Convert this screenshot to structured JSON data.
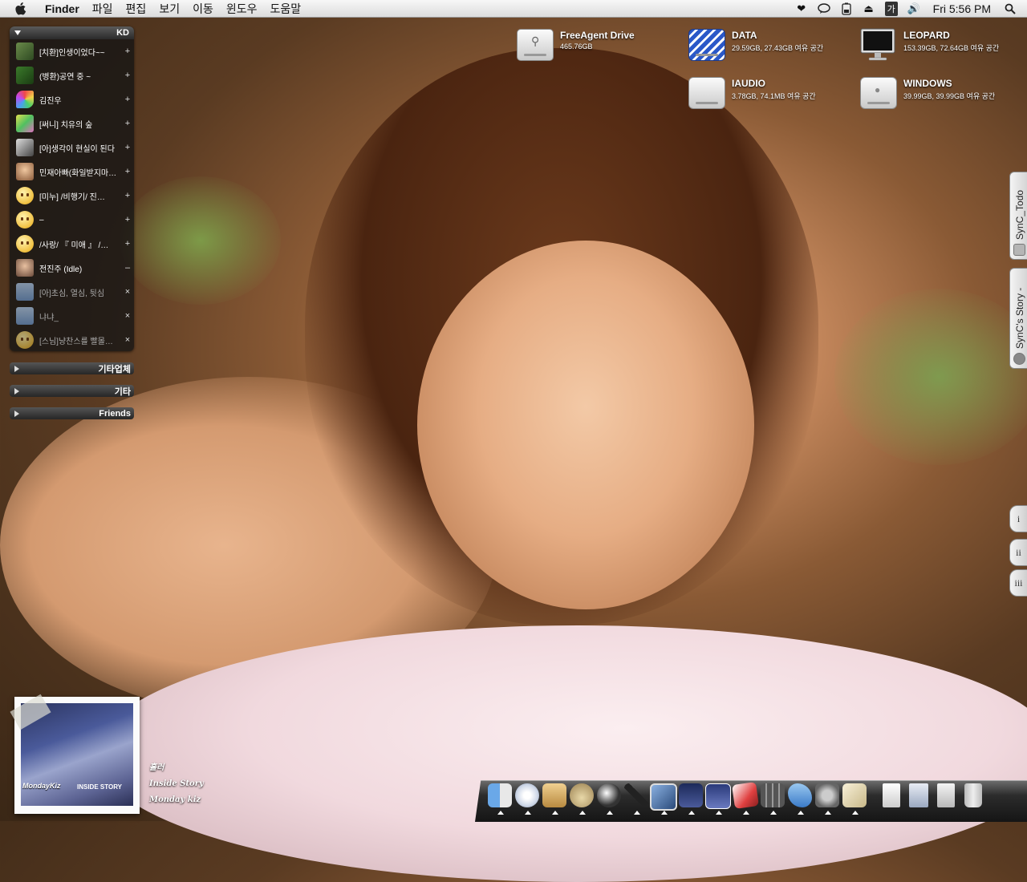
{
  "menubar": {
    "app_name": "Finder",
    "menus": [
      "파일",
      "편집",
      "보기",
      "이동",
      "윈도우",
      "도움말"
    ],
    "input_indicator": "가",
    "clock": "Fri 5:56 PM"
  },
  "buddy_list": {
    "group_name": "KD",
    "buddies": [
      {
        "name": "[치환]인생이었다~~",
        "status": "+"
      },
      {
        "name": "(병환)공연 중 ~",
        "status": "+"
      },
      {
        "name": "김진우",
        "status": "+"
      },
      {
        "name": "[써니] 치유의 숲",
        "status": "+"
      },
      {
        "name": "[아]생각이 현실이 된다",
        "status": "+"
      },
      {
        "name": "민재아빠(화일받지마…",
        "status": "+"
      },
      {
        "name": "[미누] /비행기/ 진…",
        "status": "+"
      },
      {
        "name": "–",
        "status": "+"
      },
      {
        "name": "/사랑/ 『 미애 』 /…",
        "status": "+"
      },
      {
        "name": "전진주 (Idle)",
        "status": "–"
      },
      {
        "name": "[아]초심, 열심, 뒷심",
        "status": "×"
      },
      {
        "name": "냐냐_",
        "status": "×"
      },
      {
        "name": "[스님]냥찬스를 빨몰…",
        "status": "×"
      }
    ],
    "groups": [
      "기타업체",
      "기타",
      "Friends"
    ]
  },
  "desktop_icons": [
    {
      "name": "FreeAgent Drive",
      "detail": "465.76GB"
    },
    {
      "name": "DATA",
      "detail": "29.59GB, 27.43GB 여유 공간"
    },
    {
      "name": "LEOPARD",
      "detail": "153.39GB, 72.64GB 여유 공간"
    },
    {
      "name": "IAUDIO",
      "detail": "3.78GB, 74.1MB 여유 공간"
    },
    {
      "name": "WINDOWS",
      "detail": "39.99GB, 39.99GB 여유 공간"
    }
  ],
  "side_tabs": {
    "todo": "SynC_Todo",
    "story": "SynC's Story -",
    "roman": [
      "i",
      "ii",
      "iii"
    ]
  },
  "itunes_widget": {
    "album_caption": "MondayKiz",
    "album_subcaption": "INSIDE STORY",
    "track": "흘러",
    "album": "Inside Story",
    "artist": "Monday kiz"
  }
}
